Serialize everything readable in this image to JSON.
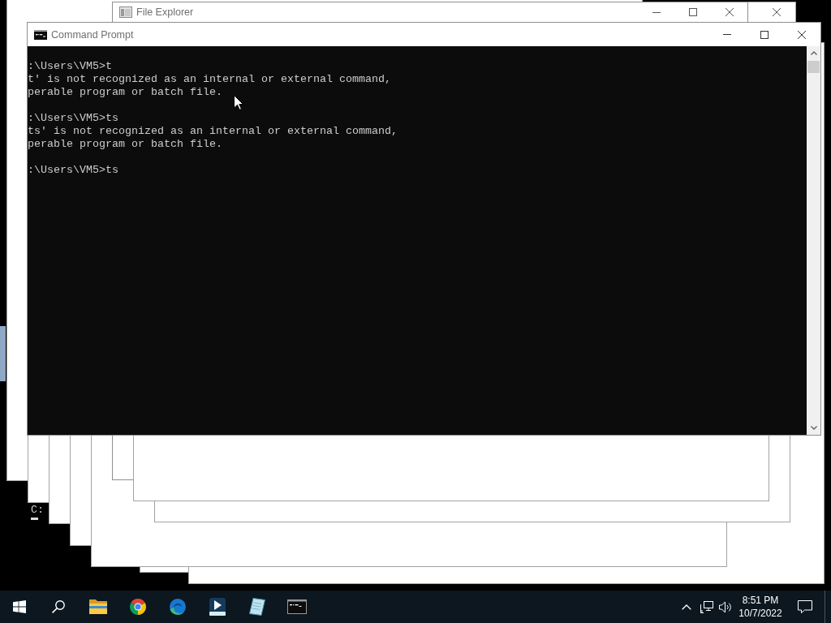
{
  "file_explorer": {
    "title": "File Explorer"
  },
  "command_prompt": {
    "title": "Command Prompt",
    "entries": [
      {
        "command": ":\\Users\\VM5>t",
        "output": [
          "t' is not recognized as an internal or external command,",
          "perable program or batch file."
        ]
      },
      {
        "command": ":\\Users\\VM5>ts",
        "output": [
          "ts' is not recognized as an internal or external command,",
          "perable program or batch file."
        ]
      },
      {
        "command": ":\\Users\\VM5>ts"
      }
    ]
  },
  "console_fragment": {
    "text": "C:"
  },
  "taskbar": {
    "apps": [
      {
        "kind": "start"
      },
      {
        "kind": "search"
      },
      {
        "kind": "folder"
      },
      {
        "kind": "tricolor"
      },
      {
        "kind": "swirl"
      },
      {
        "kind": "tile"
      },
      {
        "kind": "notepad"
      },
      {
        "kind": "terminal"
      }
    ],
    "tray": {
      "time": "8:51 PM",
      "date": "10/7/2022"
    }
  }
}
